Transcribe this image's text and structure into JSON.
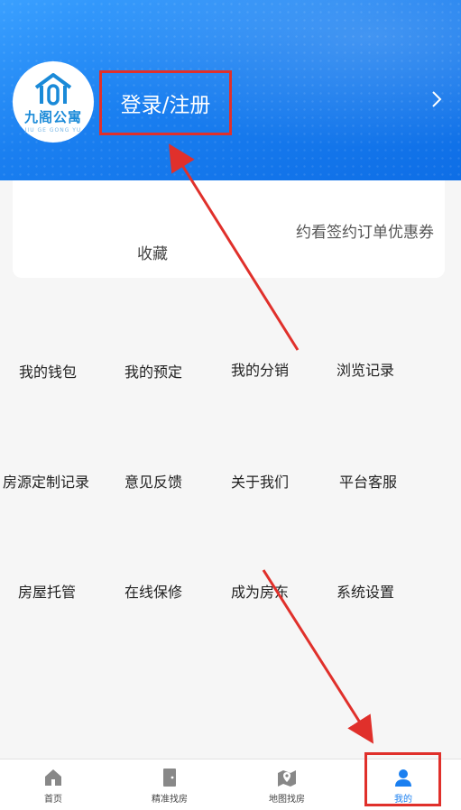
{
  "profile": {
    "logo_text": "九阁公寓",
    "logo_subtext": "JIU GE GONG YU",
    "login_label": "登录/注册"
  },
  "stats": {
    "favorites_label": "收藏",
    "right_label": "约看签约订单优惠券"
  },
  "menu": {
    "rows": [
      [
        "我的钱包",
        "我的预定",
        "我的分销",
        "浏览记录"
      ],
      [
        "房源定制记录",
        "意见反馈",
        "关于我们",
        "平台客服"
      ],
      [
        "房屋托管",
        "在线保修",
        "成为房东",
        "系统设置"
      ]
    ]
  },
  "tabbar": {
    "items": [
      {
        "label": "首页",
        "icon": "home-icon"
      },
      {
        "label": "精准找房",
        "icon": "door-icon"
      },
      {
        "label": "地图找房",
        "icon": "map-pin-icon"
      },
      {
        "label": "我的",
        "icon": "user-icon"
      }
    ],
    "active_index": 3
  },
  "colors": {
    "header_blue": "#1a7ff0",
    "annotation_red": "#e0302b",
    "active_tab": "#1a7ff0"
  }
}
